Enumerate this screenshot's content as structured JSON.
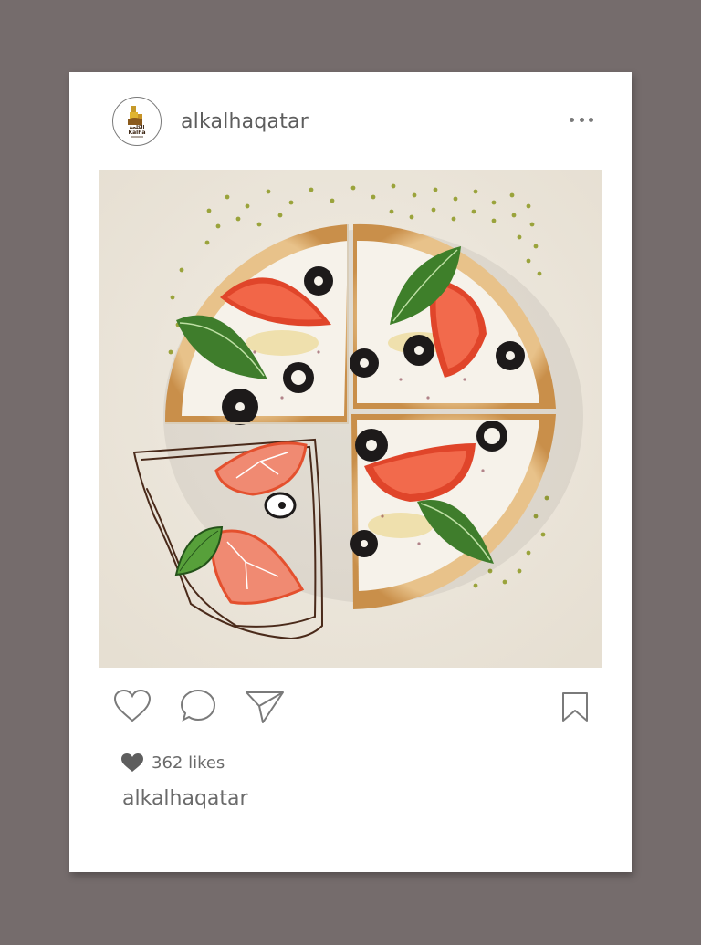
{
  "post": {
    "username": "alkalhaqatar",
    "likes_text": "362 likes",
    "caption_username": "alkalhaqatar"
  },
  "avatar": {
    "logo_text_latin": "Kalha",
    "logo_text_arabic": "الكلحة"
  },
  "icons": {
    "heart": "heart-icon",
    "comment": "comment-icon",
    "share": "send-icon",
    "bookmark": "bookmark-icon",
    "more": "more-icon",
    "likes_heart": "filled-heart-icon"
  },
  "colors": {
    "background": "#756c6c",
    "card": "#ffffff",
    "text": "#6a6a6a",
    "icon_stroke": "#7a7a7a"
  }
}
